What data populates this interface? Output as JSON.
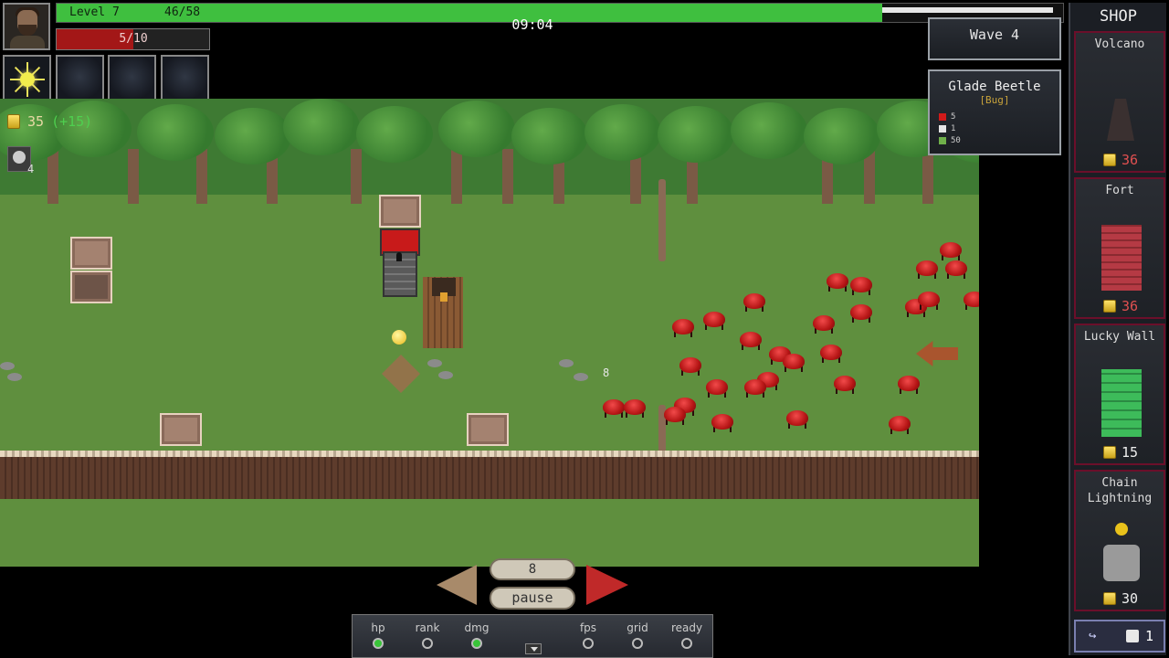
{
  "hud": {
    "level_label": "Level 7",
    "xp_text": "46/58",
    "xp_progress": 0.672,
    "wave_progress": 0.82,
    "hp_text": "5/10",
    "hp_progress": 0.5,
    "timer": "09:04",
    "gold_amount": "35",
    "gold_bonus": "(+15)",
    "bomb_count": "4",
    "skills": [
      "sun-skill",
      "empty",
      "empty",
      "empty"
    ]
  },
  "wave": {
    "label": "Wave 4"
  },
  "enemy_info": {
    "name": "Glade Beetle",
    "type": "[Bug]",
    "stats": [
      {
        "icon": "heart-icon",
        "value": "5",
        "color": "#d11a1a"
      },
      {
        "icon": "speed-icon",
        "value": "1",
        "color": "#e6e6e6"
      },
      {
        "icon": "reward-icon",
        "value": "50",
        "color": "#6fb04a"
      }
    ]
  },
  "field": {
    "damage_number": "8"
  },
  "shop": {
    "title": "SHOP",
    "items": [
      {
        "name": "Volcano",
        "price": "36",
        "affordable": false
      },
      {
        "name": "Fort",
        "price": "36",
        "affordable": false
      },
      {
        "name": "Lucky Wall",
        "price": "15",
        "affordable": true
      },
      {
        "name": "Chain\nLightning",
        "name_line1": "Chain",
        "name_line2": "Lightning",
        "price": "30",
        "affordable": true
      }
    ],
    "footer_count": "1"
  },
  "controls": {
    "speed": "8",
    "pause_label": "pause",
    "toggles": [
      {
        "label": "hp",
        "on": true
      },
      {
        "label": "rank",
        "on": false
      },
      {
        "label": "dmg",
        "on": true
      },
      {
        "label": "fps",
        "on": false
      },
      {
        "label": "grid",
        "on": false
      },
      {
        "label": "ready",
        "on": false
      }
    ]
  },
  "colors": {
    "xp": "#3fbf3f",
    "hp": "#a31717",
    "accent_red": "#c02929",
    "coin": "#e9b81b"
  }
}
